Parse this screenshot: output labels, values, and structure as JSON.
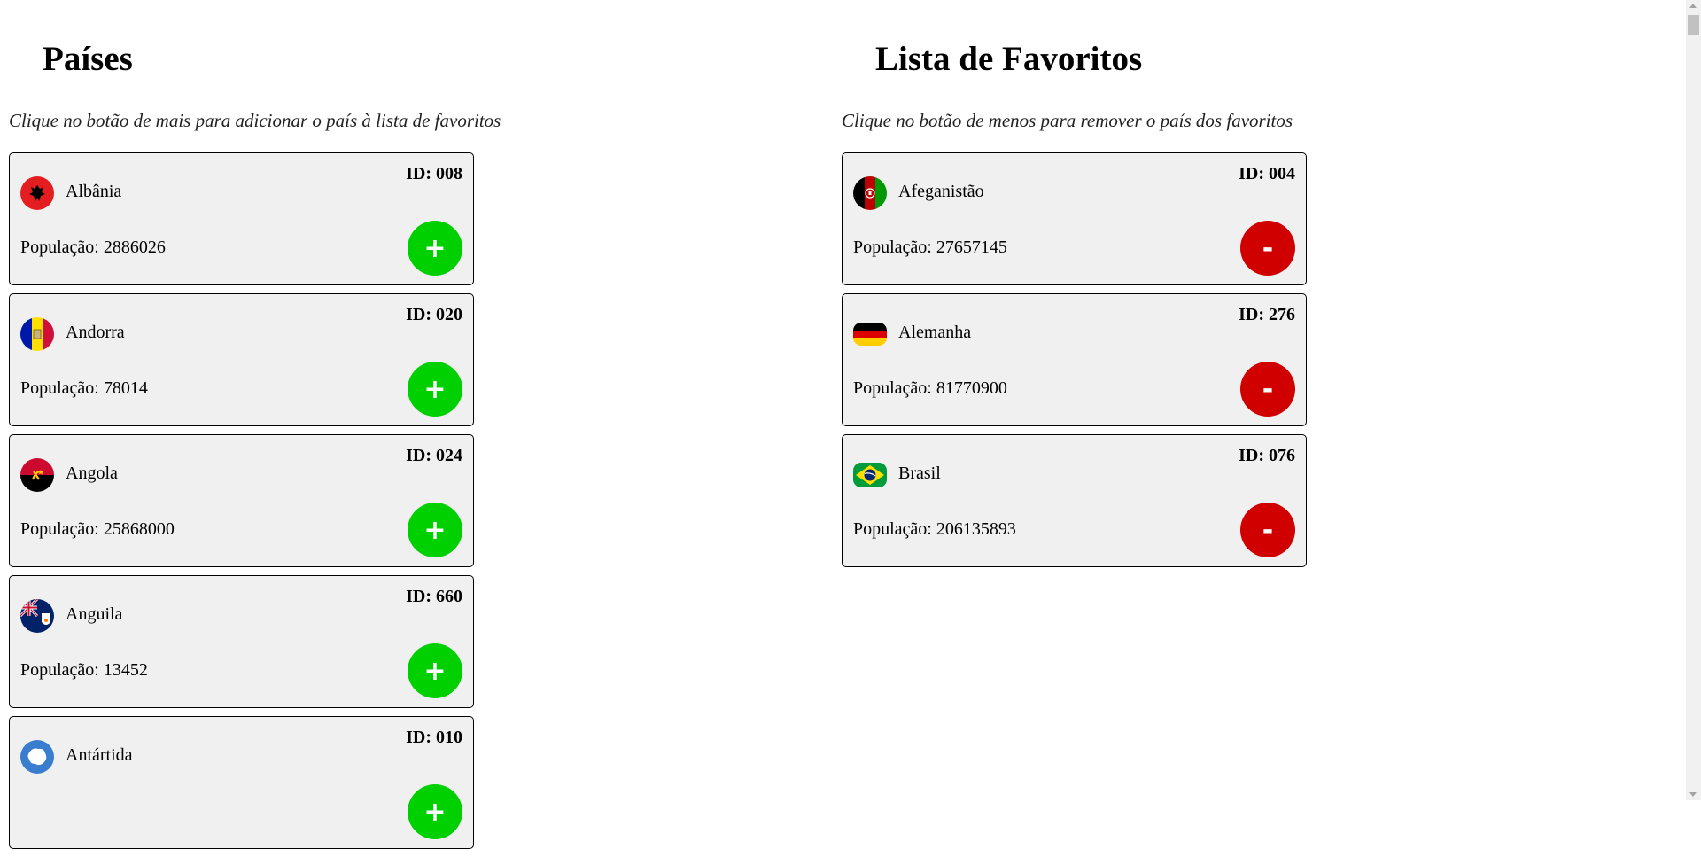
{
  "countries": {
    "title": "Países",
    "subtitle": "Clique no botão de mais para adicionar o país à lista de favoritos",
    "button_label": "+",
    "items": [
      {
        "id": "ID: 008",
        "name": "Albânia",
        "population": "População: 2886026",
        "flag_icon": "albania-flag-icon"
      },
      {
        "id": "ID: 020",
        "name": "Andorra",
        "population": "População: 78014",
        "flag_icon": "andorra-flag-icon"
      },
      {
        "id": "ID: 024",
        "name": "Angola",
        "population": "População: 25868000",
        "flag_icon": "angola-flag-icon"
      },
      {
        "id": "ID: 660",
        "name": "Anguila",
        "population": "População: 13452",
        "flag_icon": "anguilla-flag-icon"
      },
      {
        "id": "ID: 010",
        "name": "Antártida",
        "population": "",
        "flag_icon": "antarctica-flag-icon"
      }
    ]
  },
  "favorites": {
    "title": "Lista de Favoritos",
    "subtitle": "Clique no botão de menos para remover o país dos favoritos",
    "button_label": "-",
    "items": [
      {
        "id": "ID: 004",
        "name": "Afeganistão",
        "population": "População: 27657145",
        "flag_icon": "afghanistan-flag-icon"
      },
      {
        "id": "ID: 276",
        "name": "Alemanha",
        "population": "População: 81770900",
        "flag_icon": "germany-flag-icon"
      },
      {
        "id": "ID: 076",
        "name": "Brasil",
        "population": "População: 206135893",
        "flag_icon": "brazil-flag-icon"
      }
    ]
  },
  "colors": {
    "add": "#00d000",
    "remove": "#d00000",
    "card_bg": "#f0f0f0"
  }
}
